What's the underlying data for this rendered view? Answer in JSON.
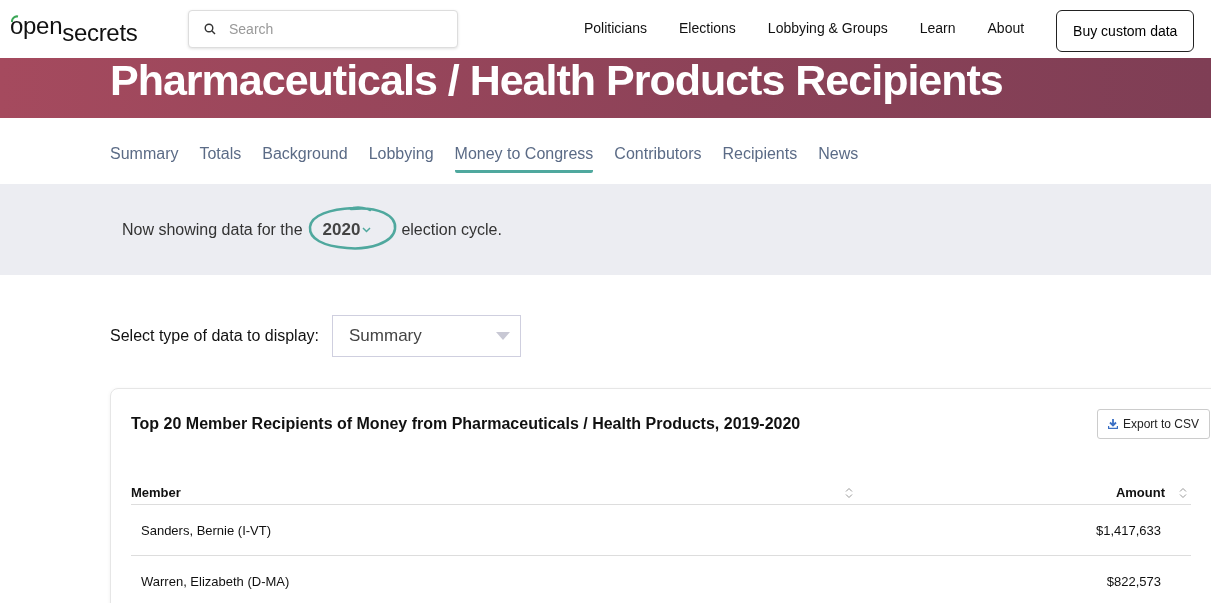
{
  "logo": {
    "part_1": "open",
    "part_2": "secrets"
  },
  "search": {
    "placeholder": "Search"
  },
  "nav": [
    "Politicians",
    "Elections",
    "Lobbying & Groups",
    "Learn",
    "About"
  ],
  "cta_button": "Buy custom data",
  "page_title": "Pharmaceuticals / Health Products Recipients",
  "tabs": [
    {
      "label": "Summary",
      "selected": false
    },
    {
      "label": "Totals",
      "selected": false
    },
    {
      "label": "Background",
      "selected": false
    },
    {
      "label": "Lobbying",
      "selected": false
    },
    {
      "label": "Money to Congress",
      "selected": true
    },
    {
      "label": "Contributors",
      "selected": false
    },
    {
      "label": "Recipients",
      "selected": false
    },
    {
      "label": "News",
      "selected": false
    }
  ],
  "cycle_bar": {
    "before": "Now showing data for the",
    "year": "2020",
    "after": "election cycle."
  },
  "data_type": {
    "label": "Select type of data to display:",
    "value": "Summary"
  },
  "table": {
    "title": "Top 20 Member Recipients of Money from Pharmaceuticals / Health Products, 2019-2020",
    "export_button": "Export to CSV",
    "columns": [
      "Member",
      "Amount"
    ],
    "rows": [
      [
        "Sanders, Bernie (I-VT)",
        "$1,417,633"
      ],
      [
        "Warren, Elizabeth (D-MA)",
        "$822,573"
      ]
    ]
  }
}
